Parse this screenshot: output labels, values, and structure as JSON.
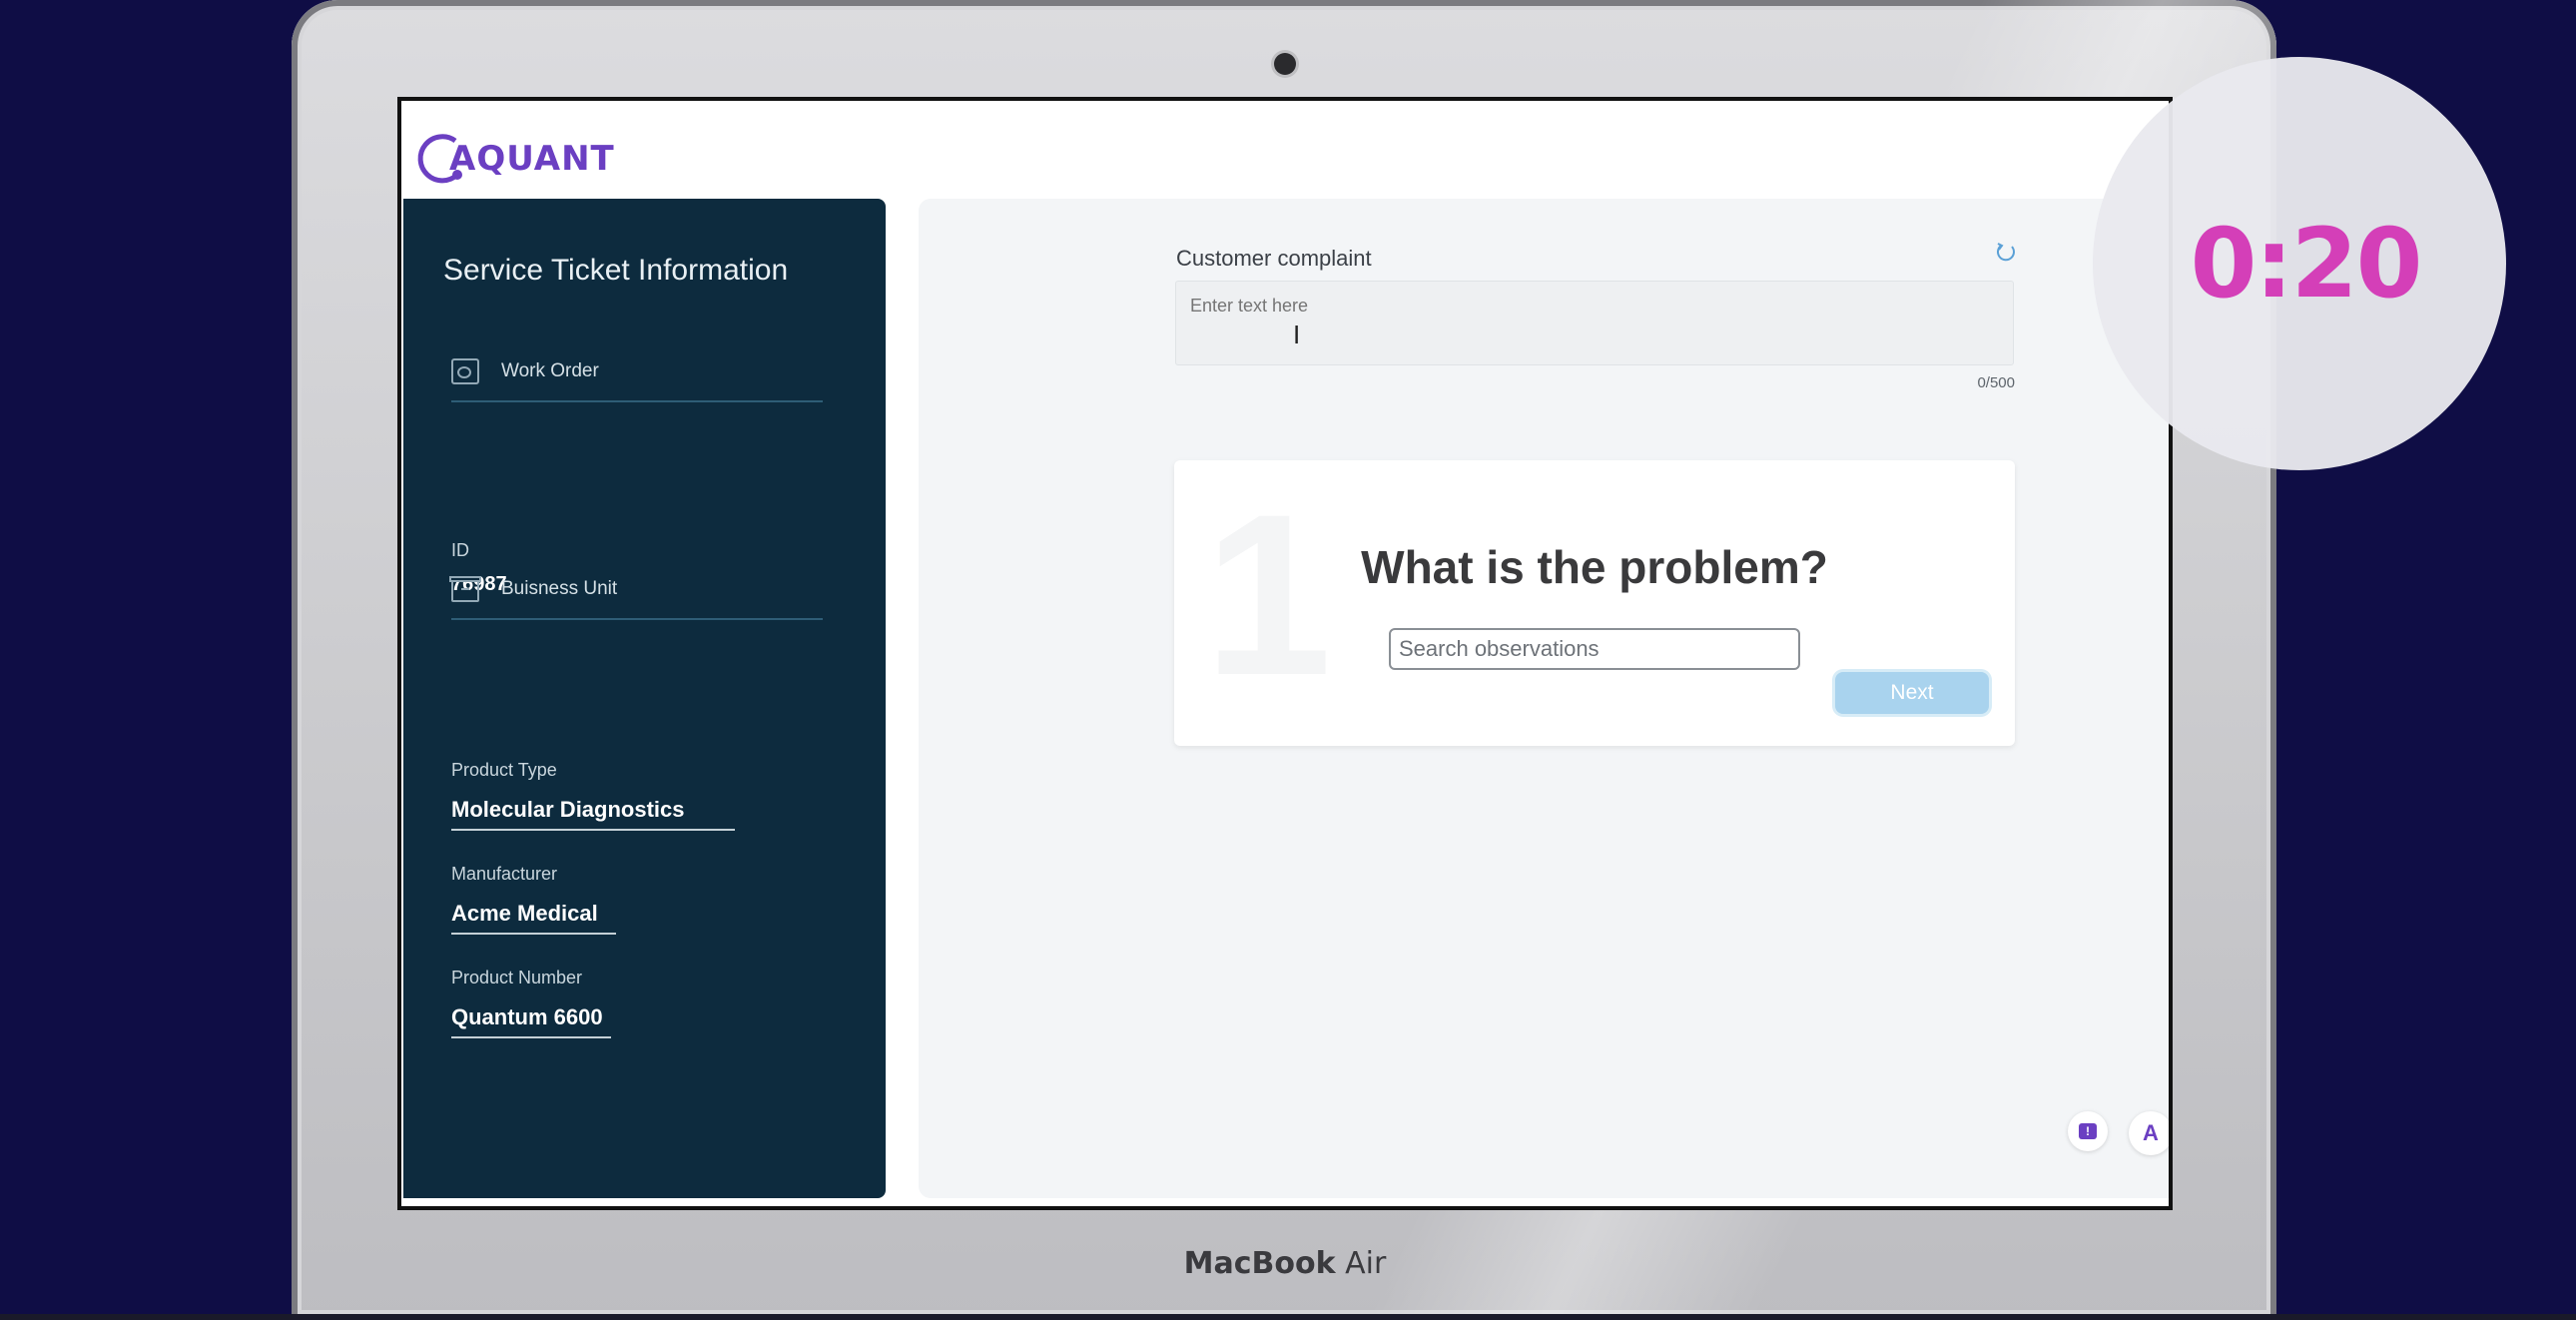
{
  "app": {
    "logo_text": "AQUANT"
  },
  "device": {
    "label_bold": "MacBook",
    "label_light": " Air"
  },
  "timer": {
    "value": "0:20"
  },
  "sidebar": {
    "title": "Service Ticket Information",
    "work_order": {
      "label": "Work Order",
      "id_label": "ID",
      "id_value": "76987"
    },
    "business_unit": {
      "label": "Buisness Unit"
    },
    "fields": [
      {
        "label": "Product Type",
        "value": "Molecular Diagnostics"
      },
      {
        "label": "Manufacturer",
        "value": "Acme Medical"
      },
      {
        "label": "Product Number",
        "value": "Quantum 6600"
      }
    ]
  },
  "complaint": {
    "label": "Customer complaint",
    "placeholder": "Enter text here",
    "counter": "0/500"
  },
  "problem_card": {
    "watermark": "1",
    "title": "What is the problem?",
    "search_placeholder": "Search observations",
    "next_label": "Next"
  },
  "floating": {
    "chat_icon": "!",
    "aquant_badge": "A"
  }
}
